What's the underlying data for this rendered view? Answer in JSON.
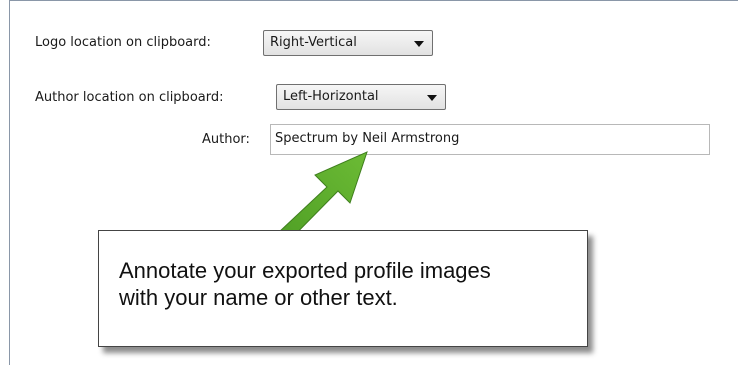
{
  "settings": {
    "logo_location": {
      "label": "Logo location on clipboard:",
      "value": "Right-Vertical"
    },
    "author_location": {
      "label": "Author location on clipboard:",
      "value": "Left-Horizontal"
    },
    "author": {
      "label": "Author:",
      "value": "Spectrum by Neil Armstrong"
    }
  },
  "callout": {
    "line1": "Annotate your exported profile images",
    "line2": "with your name or other text."
  },
  "colors": {
    "arrow": "#5aa52a",
    "panel_border": "#8a97a8"
  }
}
